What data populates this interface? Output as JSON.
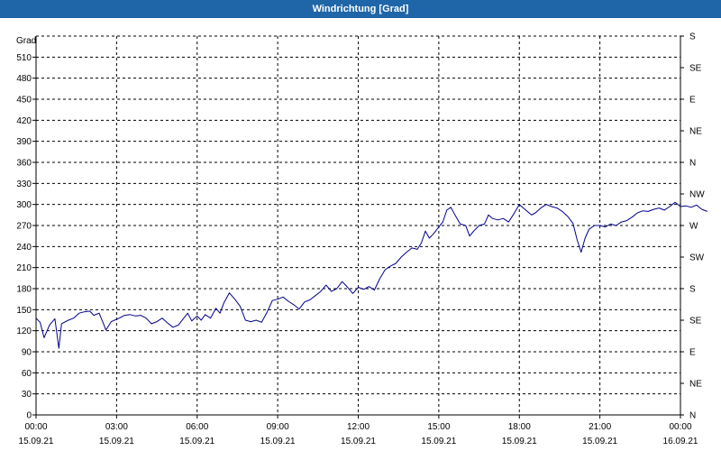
{
  "window": {
    "title": "Windrichtung [Grad]"
  },
  "chart_data": {
    "type": "line",
    "title": "Windrichtung [Grad]",
    "ylabel": "Grad",
    "xlabel": "",
    "ylim": [
      0,
      540
    ],
    "grid": true,
    "yticks": [
      0,
      30,
      60,
      90,
      120,
      150,
      180,
      210,
      240,
      270,
      300,
      330,
      360,
      390,
      420,
      450,
      480,
      510
    ],
    "right_axis_labels": [
      {
        "value": 0,
        "label": "N"
      },
      {
        "value": 45,
        "label": "NE"
      },
      {
        "value": 90,
        "label": "E"
      },
      {
        "value": 135,
        "label": "SE"
      },
      {
        "value": 180,
        "label": "S"
      },
      {
        "value": 225,
        "label": "SW"
      },
      {
        "value": 270,
        "label": "W"
      },
      {
        "value": 315,
        "label": "NW"
      },
      {
        "value": 360,
        "label": "N"
      },
      {
        "value": 405,
        "label": "NE"
      },
      {
        "value": 450,
        "label": "E"
      },
      {
        "value": 495,
        "label": "SE"
      },
      {
        "value": 540,
        "label": "S"
      }
    ],
    "xticks": [
      {
        "hour": 0,
        "time": "00:00",
        "date": "15.09.21"
      },
      {
        "hour": 3,
        "time": "03:00",
        "date": "15.09.21"
      },
      {
        "hour": 6,
        "time": "06:00",
        "date": "15.09.21"
      },
      {
        "hour": 9,
        "time": "09:00",
        "date": "15.09.21"
      },
      {
        "hour": 12,
        "time": "12:00",
        "date": "15.09.21"
      },
      {
        "hour": 15,
        "time": "15:00",
        "date": "15.09.21"
      },
      {
        "hour": 18,
        "time": "18:00",
        "date": "15.09.21"
      },
      {
        "hour": 21,
        "time": "21:00",
        "date": "15.09.21"
      },
      {
        "hour": 24,
        "time": "00:00",
        "date": "16.09.21"
      }
    ],
    "series": [
      {
        "color": "#00008b",
        "points": [
          [
            0.0,
            138
          ],
          [
            0.15,
            132
          ],
          [
            0.3,
            110
          ],
          [
            0.5,
            128
          ],
          [
            0.7,
            137
          ],
          [
            0.85,
            95
          ],
          [
            0.95,
            130
          ],
          [
            1.2,
            135
          ],
          [
            1.4,
            138
          ],
          [
            1.6,
            145
          ],
          [
            1.8,
            147
          ],
          [
            2.0,
            148
          ],
          [
            2.15,
            142
          ],
          [
            2.35,
            145
          ],
          [
            2.5,
            131
          ],
          [
            2.6,
            121
          ],
          [
            2.8,
            133
          ],
          [
            3.1,
            138
          ],
          [
            3.3,
            142
          ],
          [
            3.5,
            143
          ],
          [
            3.7,
            141
          ],
          [
            3.9,
            142
          ],
          [
            4.1,
            138
          ],
          [
            4.3,
            130
          ],
          [
            4.5,
            133
          ],
          [
            4.7,
            138
          ],
          [
            4.9,
            131
          ],
          [
            5.1,
            125
          ],
          [
            5.3,
            128
          ],
          [
            5.5,
            138
          ],
          [
            5.65,
            145
          ],
          [
            5.8,
            134
          ],
          [
            6.0,
            141
          ],
          [
            6.15,
            135
          ],
          [
            6.3,
            143
          ],
          [
            6.5,
            138
          ],
          [
            6.7,
            152
          ],
          [
            6.85,
            145
          ],
          [
            7.0,
            160
          ],
          [
            7.2,
            174
          ],
          [
            7.4,
            165
          ],
          [
            7.6,
            155
          ],
          [
            7.8,
            135
          ],
          [
            8.0,
            133
          ],
          [
            8.2,
            135
          ],
          [
            8.4,
            132
          ],
          [
            8.6,
            146
          ],
          [
            8.8,
            163
          ],
          [
            9.0,
            165
          ],
          [
            9.2,
            168
          ],
          [
            9.4,
            162
          ],
          [
            9.6,
            157
          ],
          [
            9.8,
            151
          ],
          [
            10.0,
            161
          ],
          [
            10.2,
            164
          ],
          [
            10.4,
            170
          ],
          [
            10.6,
            176
          ],
          [
            10.8,
            185
          ],
          [
            11.0,
            176
          ],
          [
            11.2,
            180
          ],
          [
            11.4,
            190
          ],
          [
            11.6,
            182
          ],
          [
            11.8,
            173
          ],
          [
            12.0,
            182
          ],
          [
            12.2,
            179
          ],
          [
            12.4,
            183
          ],
          [
            12.6,
            178
          ],
          [
            12.8,
            194
          ],
          [
            13.0,
            207
          ],
          [
            13.2,
            212
          ],
          [
            13.4,
            216
          ],
          [
            13.6,
            225
          ],
          [
            13.8,
            232
          ],
          [
            14.0,
            238
          ],
          [
            14.2,
            236
          ],
          [
            14.35,
            245
          ],
          [
            14.5,
            262
          ],
          [
            14.65,
            252
          ],
          [
            14.8,
            258
          ],
          [
            15.0,
            268
          ],
          [
            15.15,
            275
          ],
          [
            15.3,
            292
          ],
          [
            15.45,
            296
          ],
          [
            15.6,
            285
          ],
          [
            15.8,
            272
          ],
          [
            16.0,
            270
          ],
          [
            16.15,
            255
          ],
          [
            16.3,
            262
          ],
          [
            16.5,
            270
          ],
          [
            16.7,
            272
          ],
          [
            16.85,
            285
          ],
          [
            17.0,
            280
          ],
          [
            17.2,
            278
          ],
          [
            17.4,
            280
          ],
          [
            17.6,
            275
          ],
          [
            17.8,
            287
          ],
          [
            18.0,
            300
          ],
          [
            18.15,
            295
          ],
          [
            18.3,
            290
          ],
          [
            18.45,
            285
          ],
          [
            18.6,
            288
          ],
          [
            18.8,
            295
          ],
          [
            19.0,
            300
          ],
          [
            19.2,
            297
          ],
          [
            19.4,
            295
          ],
          [
            19.6,
            290
          ],
          [
            19.8,
            283
          ],
          [
            20.0,
            273
          ],
          [
            20.15,
            250
          ],
          [
            20.3,
            232
          ],
          [
            20.45,
            252
          ],
          [
            20.6,
            265
          ],
          [
            20.8,
            270
          ],
          [
            21.0,
            270
          ],
          [
            21.2,
            268
          ],
          [
            21.4,
            272
          ],
          [
            21.6,
            270
          ],
          [
            21.8,
            275
          ],
          [
            22.0,
            277
          ],
          [
            22.2,
            282
          ],
          [
            22.4,
            288
          ],
          [
            22.6,
            291
          ],
          [
            22.8,
            290
          ],
          [
            23.0,
            293
          ],
          [
            23.2,
            295
          ],
          [
            23.4,
            292
          ],
          [
            23.6,
            297
          ],
          [
            23.8,
            303
          ],
          [
            24.0,
            297
          ],
          [
            24.2,
            298
          ],
          [
            24.4,
            296
          ],
          [
            24.6,
            299
          ],
          [
            24.8,
            293
          ],
          [
            25.0,
            290
          ]
        ]
      }
    ]
  }
}
